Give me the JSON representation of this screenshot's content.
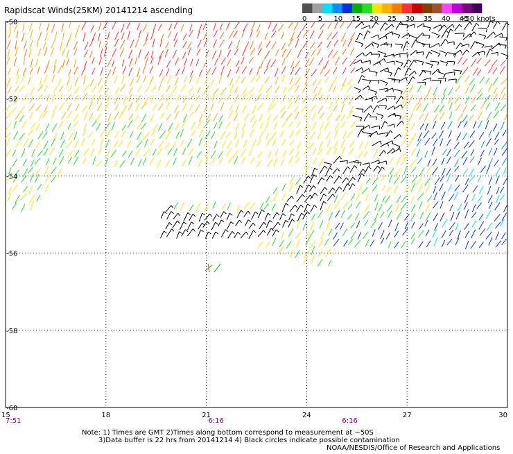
{
  "title": "Rapidscat Winds(25KM) 20141214 ascending",
  "legend": {
    "labels": [
      "0",
      "5",
      "10",
      "15",
      "20",
      "25",
      "30",
      "35",
      "40",
      "45",
      ">50 knots"
    ],
    "colors": [
      "#505050",
      "#a0a0a0",
      "#00e0ff",
      "#0090ff",
      "#0030e0",
      "#00b000",
      "#20e020",
      "#ffe000",
      "#ffb000",
      "#ff7800",
      "#ff3030",
      "#d00000",
      "#804000",
      "#a05030",
      "#ff40ff",
      "#c000e0",
      "#800080",
      "#400060"
    ]
  },
  "map": {
    "lon_ticks": [
      "15",
      "18",
      "21",
      "24",
      "27",
      "30"
    ],
    "lat_ticks": [
      "-50",
      "-52",
      "-54",
      "-56",
      "-58",
      "-60"
    ],
    "lon_range": [
      15,
      30
    ],
    "lat_range": [
      -50,
      -60
    ],
    "times": [
      {
        "lon": 15,
        "label": "7:51"
      },
      {
        "lon": 21,
        "label": "6:16"
      },
      {
        "lon": 25,
        "label": "6:16"
      }
    ]
  },
  "notes": {
    "line1": "Note: 1) Times are GMT 2)Times along bottom correspond to measurement at ~50S",
    "line2": "3)Data buffer is 22 hrs from 20141214 4) Black circles indicate possible contamination",
    "credit": "NOAA/NESDIS/Office of Research and Applications"
  },
  "colors": {
    "contaminated": "#000000",
    "grid": "#000000"
  }
}
